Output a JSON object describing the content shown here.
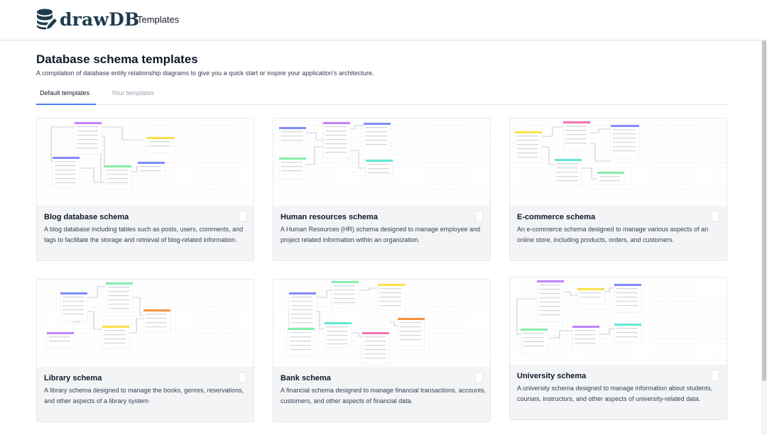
{
  "header": {
    "logo_text": "drawDB",
    "logo_icon": "database-pencil-icon",
    "nav_title": "Templates"
  },
  "page": {
    "heading": "Database schema templates",
    "subheading": "A compilation of database entity relationship diagrams to give you a quick start or inspire your application's architecture."
  },
  "tabs": [
    {
      "label": "Default templates",
      "active": true
    },
    {
      "label": "Your templates",
      "active": false
    }
  ],
  "colors": {
    "accent": "#4f7df0",
    "table_header_purple": "#c084fc",
    "table_header_blue": "#818cf8",
    "table_header_yellow": "#fde047",
    "table_header_green": "#86efac",
    "table_header_pink": "#f472b6",
    "table_header_teal": "#5eead4",
    "table_header_orange": "#fb923c"
  },
  "templates": [
    {
      "title": "Blog database schema",
      "description": "A blog database including tables such as posts, users, comments, and tags to facilitate the storage and retrieval of blog-related information."
    },
    {
      "title": "Human resources schema",
      "description": "A Human Resources (HR) schema designed to manage employee and project related information within an organization."
    },
    {
      "title": "E-commerce schema",
      "description": "An e-commerce schema designed to manage various aspects of an online store, including products, orders, and customers."
    },
    {
      "title": "Library schema",
      "description": "A library schema designed to manage the books, genres, reservations, and other aspects of a library system"
    },
    {
      "title": "Bank schema",
      "description": "A financial schema designed to manage financial transactions, accounts, customers, and other aspects of financial data."
    },
    {
      "title": "University schema",
      "description": "A university schema designed to manage information about students, courses, instructors, and other aspects of university-related data."
    }
  ]
}
